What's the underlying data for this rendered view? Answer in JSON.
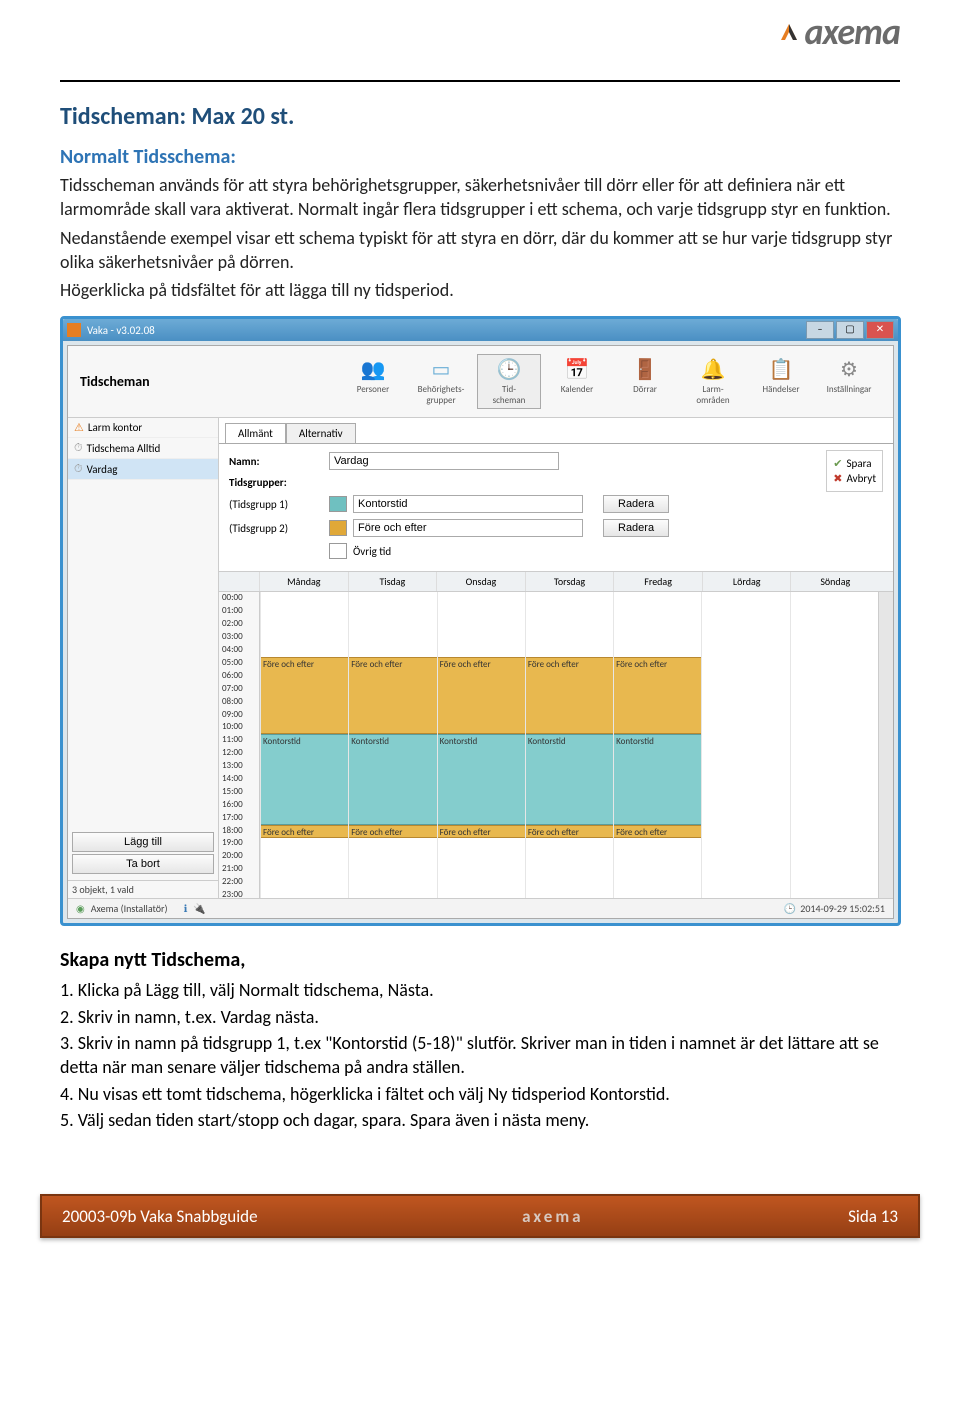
{
  "brand": "axema",
  "title": "Tidscheman: Max 20 st.",
  "subtitle": "Normalt Tidsschema:",
  "paragraphs": [
    "Tidsscheman används för att styra behörighetsgrupper, säkerhetsnivåer till dörr eller för att definiera när ett larmområde skall vara aktiverat. Normalt ingår flera tidsgrupper i ett schema, och varje tidsgrupp styr en funktion.",
    "Nedanstående exempel visar ett schema typiskt för att styra en dörr, där du kommer att se hur varje tidsgrupp styr olika säkerhetsnivåer på dörren.",
    "Högerklicka på tidsfältet för att lägga till ny tidsperiod."
  ],
  "app": {
    "windowTitle": "Vaka - v3.02.08",
    "headerTitle": "Tidscheman",
    "nav": {
      "personer": "Personer",
      "behorig": "Behörighets-\ngrupper",
      "tid": "Tid-\nscheman",
      "kalender": "Kalender",
      "dorrar": "Dörrar",
      "larm": "Larm-\nområden",
      "handelser": "Händelser",
      "installningar": "Inställningar"
    },
    "sidebar": {
      "items": {
        "larm": "Larm kontor",
        "alltid": "Tidschema Alltid",
        "vardag": "Vardag"
      },
      "lagg": "Lägg till",
      "tabort": "Ta bort",
      "status": "3 objekt, 1 vald"
    },
    "tabs": {
      "allmant": "Allmänt",
      "alternativ": "Alternativ"
    },
    "form": {
      "namnLabel": "Namn:",
      "namnValue": "Vardag",
      "tidsgrupperLabel": "Tidsgrupper:",
      "g1": "(Tidsgrupp 1)",
      "g1val": "Kontorstid",
      "g2": "(Tidsgrupp 2)",
      "g2val": "Före och efter",
      "ovrig": "Övrig tid",
      "radera": "Radera",
      "spara": "Spara",
      "avbryt": "Avbryt"
    },
    "days": {
      "mon": "Måndag",
      "tue": "Tisdag",
      "wed": "Onsdag",
      "thu": "Torsdag",
      "fri": "Fredag",
      "sat": "Lördag",
      "sun": "Söndag"
    },
    "blockLabels": {
      "fore": "Före och efter",
      "kontor": "Kontorstid"
    },
    "statusUser": "Axema (Installatör)",
    "statusPrefix": "",
    "statusTime": "2014-09-29 15:02:51"
  },
  "section2": {
    "heading": "Skapa nytt Tidschema,",
    "s1": "1. Klicka på Lägg till, välj Normalt tidschema, Nästa.",
    "s2": "2. Skriv in namn, t.ex. Vardag nästa.",
    "s3": "3. Skriv in namn på tidsgrupp 1, t.ex \"Kontorstid (5-18)\" slutför. Skriver man in tiden i namnet är det lättare att se detta när man senare väljer tidschema på andra ställen.",
    "s4": "4. Nu visas ett tomt tidschema, högerklicka i fältet och välj Ny tidsperiod Kontorstid.",
    "s5": "5. Välj sedan tiden start/stopp och dagar, spara. Spara även i nästa meny."
  },
  "footer": {
    "left": "20003-09b Vaka Snabbguide",
    "center": "axema",
    "right": "Sida 13"
  },
  "hours": [
    "00:00",
    "01:00",
    "02:00",
    "03:00",
    "04:00",
    "05:00",
    "06:00",
    "07:00",
    "08:00",
    "09:00",
    "10:00",
    "11:00",
    "12:00",
    "13:00",
    "14:00",
    "15:00",
    "16:00",
    "17:00",
    "18:00",
    "19:00",
    "20:00",
    "21:00",
    "22:00",
    "23:00"
  ]
}
